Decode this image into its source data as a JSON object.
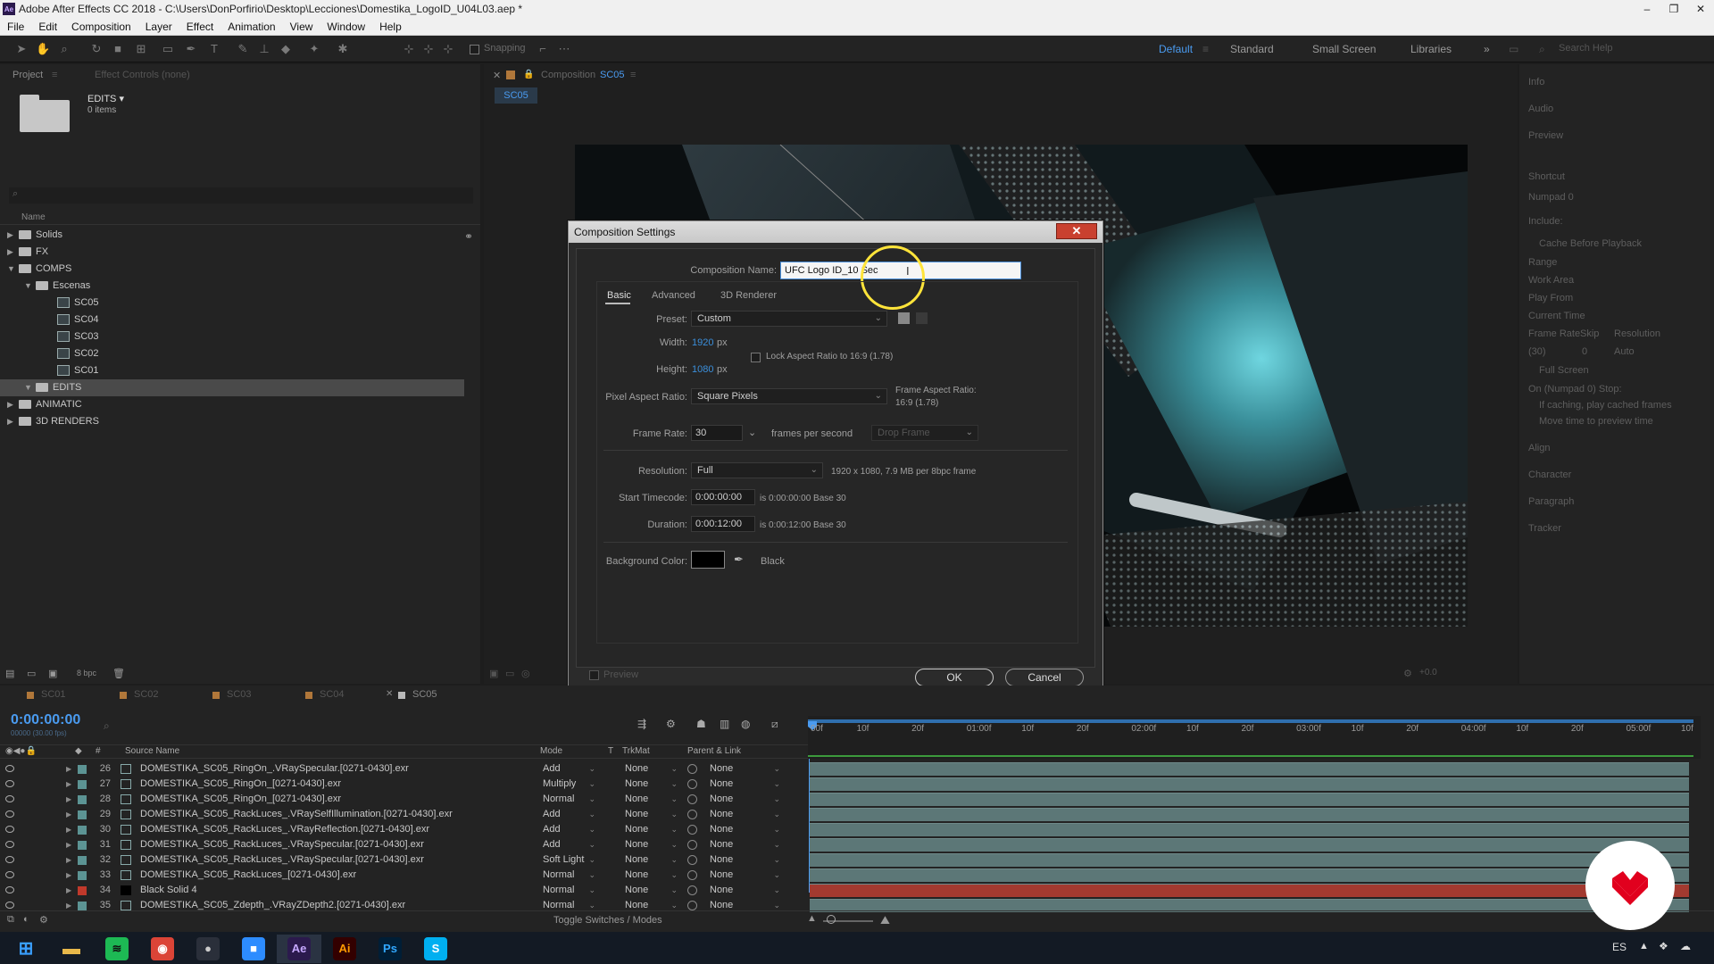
{
  "window": {
    "app_badge": "Ae",
    "title": "Adobe After Effects CC 2018 - C:\\Users\\DonPorfirio\\Desktop\\Lecciones\\Domestika_LogoID_U04L03.aep *",
    "minimize": "–",
    "restore": "❐",
    "close": "✕"
  },
  "menu": [
    "File",
    "Edit",
    "Composition",
    "Layer",
    "Effect",
    "Animation",
    "View",
    "Window",
    "Help"
  ],
  "toolbar": {
    "snapping_label": "Snapping",
    "workspaces": [
      "Default",
      "Standard",
      "Small Screen",
      "Libraries"
    ],
    "more_workspaces": "»",
    "search_help_placeholder": "Search Help"
  },
  "project_panel": {
    "tab_project": "Project",
    "tab_effect_controls": "Effect Controls (none)",
    "selected_item_name": "EDITS ▾",
    "selected_item_info": "0 items",
    "column_name": "Name",
    "tree": [
      {
        "label": "Solids",
        "level": 0,
        "type": "folder",
        "expanded": false
      },
      {
        "label": "FX",
        "level": 0,
        "type": "folder",
        "expanded": false
      },
      {
        "label": "COMPS",
        "level": 0,
        "type": "folder",
        "expanded": true
      },
      {
        "label": "Escenas",
        "level": 1,
        "type": "folder",
        "expanded": true
      },
      {
        "label": "SC05",
        "level": 2,
        "type": "comp"
      },
      {
        "label": "SC04",
        "level": 2,
        "type": "comp"
      },
      {
        "label": "SC03",
        "level": 2,
        "type": "comp"
      },
      {
        "label": "SC02",
        "level": 2,
        "type": "comp"
      },
      {
        "label": "SC01",
        "level": 2,
        "type": "comp"
      },
      {
        "label": "EDITS",
        "level": 1,
        "type": "folder",
        "expanded": true,
        "selected": true
      },
      {
        "label": "ANIMATIC",
        "level": 0,
        "type": "folder",
        "expanded": false
      },
      {
        "label": "3D RENDERS",
        "level": 0,
        "type": "folder",
        "expanded": false
      }
    ],
    "bpc_label": "8 bpc"
  },
  "composition_panel": {
    "header_prefix": "Composition",
    "header_comp": "SC05",
    "tab": "SC05",
    "exposure": "+0.0"
  },
  "dialog": {
    "title": "Composition Settings",
    "close": "✕",
    "comp_name_label": "Composition Name:",
    "comp_name_value": "UFC Logo ID_10 Sec",
    "tabs": [
      "Basic",
      "Advanced",
      "3D Renderer"
    ],
    "preset_label": "Preset:",
    "preset_value": "Custom",
    "width_label": "Width:",
    "width_value": "1920",
    "width_unit": "px",
    "height_label": "Height:",
    "height_value": "1080",
    "height_unit": "px",
    "lock_aspect_label": "Lock Aspect Ratio to 16:9 (1.78)",
    "par_label": "Pixel Aspect Ratio:",
    "par_value": "Square Pixels",
    "frame_aspect_label": "Frame Aspect Ratio:",
    "frame_aspect_value": "16:9 (1.78)",
    "frame_rate_label": "Frame Rate:",
    "frame_rate_value": "30",
    "fps_label": "frames per second",
    "drop_frame": "Drop Frame",
    "resolution_label": "Resolution:",
    "resolution_value": "Full",
    "resolution_info": "1920 x 1080, 7.9 MB per 8bpc frame",
    "start_tc_label": "Start Timecode:",
    "start_tc_value": "0:00:00:00",
    "start_tc_info": "is 0:00:00:00  Base 30",
    "duration_label": "Duration:",
    "duration_value": "0:00:12:00",
    "duration_info": "is 0:00:12:00  Base 30",
    "bg_color_label": "Background Color:",
    "bg_color_name": "Black",
    "bg_color_hex": "#000000",
    "preview_label": "Preview",
    "ok": "OK",
    "cancel": "Cancel"
  },
  "right_panel": {
    "items": [
      "Info",
      "Audio",
      "Preview",
      "Shortcut",
      "Numpad 0",
      "Include:",
      "Cache Before Playback",
      "Range",
      "Work Area",
      "Play From",
      "Current Time",
      "Frame Rate",
      "Skip",
      "Resolution",
      "(30)",
      "0",
      "Auto",
      "Full Screen",
      "On (Numpad 0) Stop:",
      "If caching, play cached frames",
      "Move time to preview time",
      "Align",
      "Character",
      "Paragraph",
      "Tracker"
    ]
  },
  "timeline": {
    "tabs": [
      "SC01",
      "SC02",
      "SC03",
      "SC04",
      "SC05"
    ],
    "tab_colors": [
      "#b0773a",
      "#b0773a",
      "#b0773a",
      "#b0773a",
      "#b9b9b9"
    ],
    "current_time": "0:00:00:00",
    "current_time_sub": "00000 (30.00 fps)",
    "col_source_name": "Source Name",
    "col_mode": "Mode",
    "col_t": "T",
    "col_trkmat": "TrkMat",
    "col_parent": "Parent & Link",
    "ruler": [
      "00f",
      "10f",
      "20f",
      "01:00f",
      "10f",
      "20f",
      "02:00f",
      "10f",
      "20f",
      "03:00f",
      "10f",
      "20f",
      "04:00f",
      "10f",
      "20f",
      "05:00f",
      "10f"
    ],
    "layers": [
      {
        "num": "26",
        "name": "DOMESTIKA_SC05_RingOn_.VRaySpecular.[0271-0430].exr",
        "mode": "Add",
        "trkmat": "None",
        "parent": "None",
        "color": "#5c9494"
      },
      {
        "num": "27",
        "name": "DOMESTIKA_SC05_RingOn_[0271-0430].exr",
        "mode": "Multiply",
        "trkmat": "None",
        "parent": "None",
        "color": "#5c9494"
      },
      {
        "num": "28",
        "name": "DOMESTIKA_SC05_RingOn_[0271-0430].exr",
        "mode": "Normal",
        "trkmat": "None",
        "parent": "None",
        "color": "#5c9494"
      },
      {
        "num": "29",
        "name": "DOMESTIKA_SC05_RackLuces_.VRaySelfIllumination.[0271-0430].exr",
        "mode": "Add",
        "trkmat": "None",
        "parent": "None",
        "color": "#5c9494"
      },
      {
        "num": "30",
        "name": "DOMESTIKA_SC05_RackLuces_.VRayReflection.[0271-0430].exr",
        "mode": "Add",
        "trkmat": "None",
        "parent": "None",
        "color": "#5c9494"
      },
      {
        "num": "31",
        "name": "DOMESTIKA_SC05_RackLuces_.VRaySpecular.[0271-0430].exr",
        "mode": "Add",
        "trkmat": "None",
        "parent": "None",
        "color": "#5c9494"
      },
      {
        "num": "32",
        "name": "DOMESTIKA_SC05_RackLuces_.VRaySpecular.[0271-0430].exr",
        "mode": "Soft Light",
        "trkmat": "None",
        "parent": "None",
        "color": "#5c9494"
      },
      {
        "num": "33",
        "name": "DOMESTIKA_SC05_RackLuces_[0271-0430].exr",
        "mode": "Normal",
        "trkmat": "None",
        "parent": "None",
        "color": "#5c9494"
      },
      {
        "num": "34",
        "name": "Black Solid 4",
        "mode": "Normal",
        "trkmat": "None",
        "parent": "None",
        "color": "#c0392b"
      },
      {
        "num": "35",
        "name": "DOMESTIKA_SC05_Zdepth_.VRayZDepth2.[0271-0430].exr",
        "mode": "Normal",
        "trkmat": "None",
        "parent": "None",
        "color": "#5c9494"
      }
    ],
    "toggle_label": "Toggle Switches / Modes"
  },
  "taskbar": {
    "apps": [
      {
        "name": "windows-start",
        "glyph": "⊞",
        "color": "#3aa0ff",
        "bg": "transparent"
      },
      {
        "name": "file-explorer",
        "glyph": "▬",
        "color": "#e8b84a",
        "bg": "transparent"
      },
      {
        "name": "spotify",
        "glyph": "≋",
        "color": "#111",
        "bg": "#1db954"
      },
      {
        "name": "chrome",
        "glyph": "◉",
        "color": "#fff",
        "bg": "#db4437"
      },
      {
        "name": "obs",
        "glyph": "●",
        "color": "#ccc",
        "bg": "#2a2f3a"
      },
      {
        "name": "zoom",
        "glyph": "■",
        "color": "#fff",
        "bg": "#2d8cff"
      },
      {
        "name": "after-effects",
        "glyph": "Ae",
        "color": "#c6a8ff",
        "bg": "#2b1a4d"
      },
      {
        "name": "illustrator",
        "glyph": "Ai",
        "color": "#ff9a00",
        "bg": "#330000"
      },
      {
        "name": "photoshop",
        "glyph": "Ps",
        "color": "#31a8ff",
        "bg": "#001e36"
      },
      {
        "name": "skype",
        "glyph": "S",
        "color": "#fff",
        "bg": "#00aff0"
      }
    ],
    "lang": "ES"
  },
  "watermark": {
    "brand": "domestika",
    "color": "#e1001e"
  }
}
